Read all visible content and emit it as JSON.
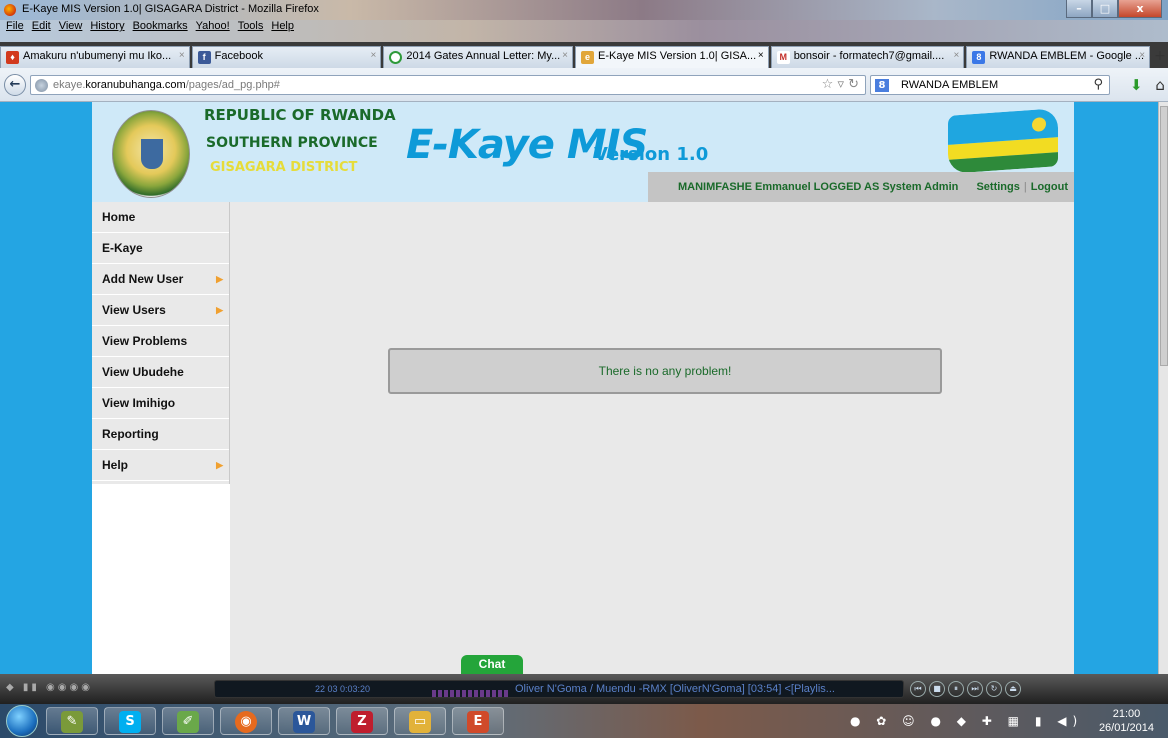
{
  "window": {
    "title": "E-Kaye MIS Version 1.0| GISAGARA District - Mozilla Firefox",
    "controls": [
      "–",
      "□",
      "x"
    ]
  },
  "menu": [
    "File",
    "Edit",
    "View",
    "History",
    "Bookmarks",
    "Yahoo!",
    "Tools",
    "Help"
  ],
  "tabs": [
    {
      "label": "Amakuru n'ubumenyi mu Iko...",
      "icon": "flame-icon",
      "color": "#d23a1e"
    },
    {
      "label": "Facebook",
      "icon": "facebook-icon",
      "color": "#3b5998"
    },
    {
      "label": "2014 Gates Annual Letter: My...",
      "icon": "loading-icon",
      "color": "#2e9a3a"
    },
    {
      "label": "E-Kaye MIS Version 1.0| GISA...",
      "icon": "page-icon",
      "color": "#e1a63a",
      "active": true
    },
    {
      "label": "bonsoir - formatech7@gmail....",
      "icon": "gmail-icon",
      "color": "#c4302b"
    },
    {
      "label": "RWANDA EMBLEM - Google ...",
      "icon": "google-icon",
      "color": "#3b78e7"
    }
  ],
  "nav": {
    "url_prefix": "ekaye.",
    "url_domain": "koranubuhanga.com",
    "url_path": "/pages/ad_pg.php#",
    "search_text": "RWANDA EMBLEM"
  },
  "header": {
    "line1": "REPUBLIC OF RWANDA",
    "line2": "SOUTHERN PROVINCE",
    "line3": "GISAGARA DISTRICT",
    "app_name": "E-Kaye MIS",
    "app_version": "Version 1.0",
    "user_info": "MANIMFASHE Emmanuel  LOGGED AS System Admin",
    "settings": "Settings",
    "separator": "|",
    "logout": "Logout"
  },
  "sidebar": [
    {
      "label": "Home",
      "submenu": false
    },
    {
      "label": "E-Kaye",
      "submenu": false
    },
    {
      "label": "Add New User",
      "submenu": true
    },
    {
      "label": "View Users",
      "submenu": true
    },
    {
      "label": "View Problems",
      "submenu": false
    },
    {
      "label": "View Ubudehe",
      "submenu": false
    },
    {
      "label": "View Imihigo",
      "submenu": false
    },
    {
      "label": "Reporting",
      "submenu": false
    },
    {
      "label": "Help",
      "submenu": true
    }
  ],
  "main": {
    "message": "There is no any problem!"
  },
  "chat": {
    "label": "Chat"
  },
  "media": {
    "counter": "22   03   0:03:20",
    "track": "Oliver N'Goma / Muendu -RMX [OliverN'Goma] [03:54]  <[Playlis..."
  },
  "taskbar": {
    "apps": [
      {
        "icon": "paint-icon",
        "glyph": "✎",
        "color": "#7a9a3a"
      },
      {
        "icon": "skype-icon",
        "glyph": "S",
        "color": "#00aff0"
      },
      {
        "icon": "draw-icon",
        "glyph": "✐",
        "color": "#6aa84a"
      },
      {
        "icon": "firefox-icon",
        "glyph": "◉",
        "color": "#e66a1e"
      },
      {
        "icon": "word-icon",
        "glyph": "W",
        "color": "#2b579a"
      },
      {
        "icon": "filezilla-icon",
        "glyph": "Z",
        "color": "#bf1e2e"
      },
      {
        "icon": "explorer-icon",
        "glyph": "▭",
        "color": "#e2b23a"
      },
      {
        "icon": "presentation-icon",
        "glyph": "E",
        "color": "#d04a2a"
      }
    ],
    "time": "21:00",
    "date": "26/01/2014"
  }
}
